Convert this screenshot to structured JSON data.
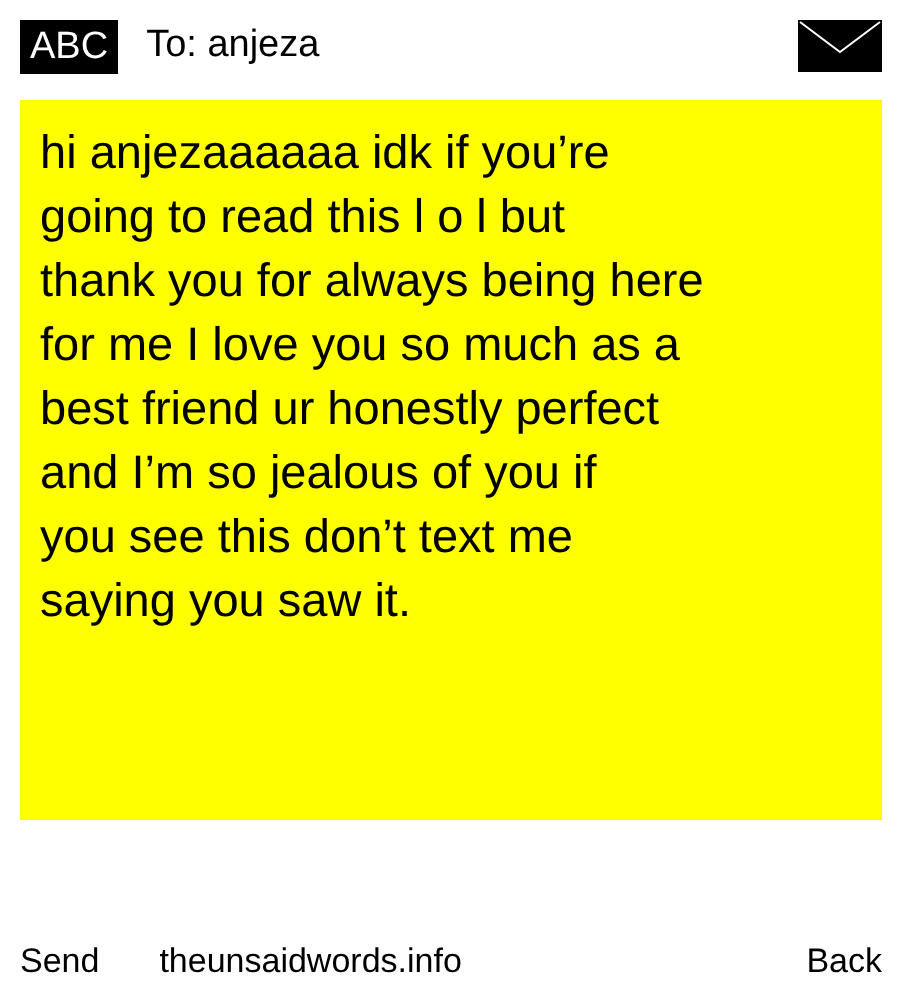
{
  "header": {
    "mode_badge": "ABC",
    "recipient": "To: anjeza"
  },
  "message": {
    "lines": [
      "hi anjezaaaaaa idk if you’re",
      "going to read this l o l but",
      "thank you for always being here",
      "for me I love you so much as a",
      "best friend ur honestly perfect",
      "and I’m so jealous of you if",
      "you see this don’t text me",
      "saying you saw it."
    ]
  },
  "footer": {
    "left": "Send",
    "site": "theunsaidwords.info",
    "right": "Back"
  }
}
